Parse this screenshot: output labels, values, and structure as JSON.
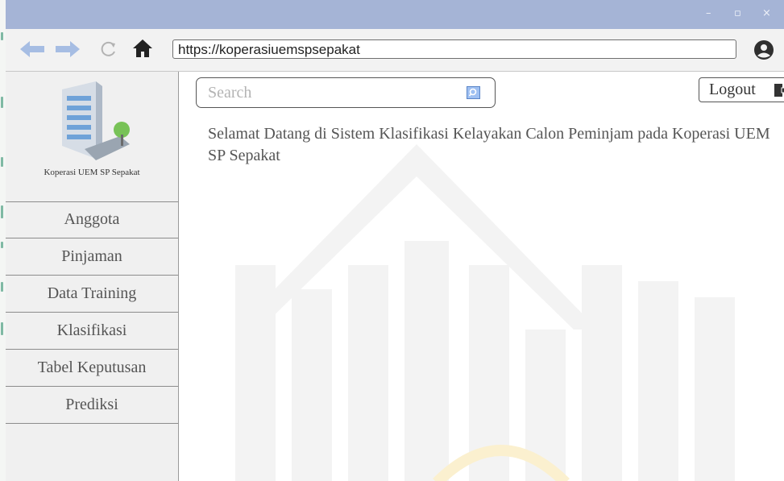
{
  "window": {
    "controls": {
      "minimize": "–",
      "maximize": "▫",
      "close": "×"
    }
  },
  "browser": {
    "url": "https://koperasiuemspsepakat",
    "icons": [
      "back-arrow-icon",
      "forward-arrow-icon",
      "reload-icon",
      "home-icon",
      "user-account-icon"
    ]
  },
  "sidebar": {
    "logo_caption": "Koperasi UEM SP Sepakat",
    "items": [
      {
        "label": "Anggota"
      },
      {
        "label": "Pinjaman"
      },
      {
        "label": "Data Training"
      },
      {
        "label": "Klasifikasi"
      },
      {
        "label": "Tabel Keputusan"
      },
      {
        "label": "Prediksi"
      }
    ]
  },
  "header": {
    "search_placeholder": "Search",
    "logout_label": "Logout"
  },
  "main": {
    "welcome_text": "Selamat Datang di Sistem Klasifikasi Kelayakan Calon Peminjam pada Koperasi UEM SP Sepakat"
  },
  "colors": {
    "titlebar": "#a5b4d6",
    "nav_arrow": "#a6bde3",
    "sidebar_bg": "#f0f0f0"
  }
}
